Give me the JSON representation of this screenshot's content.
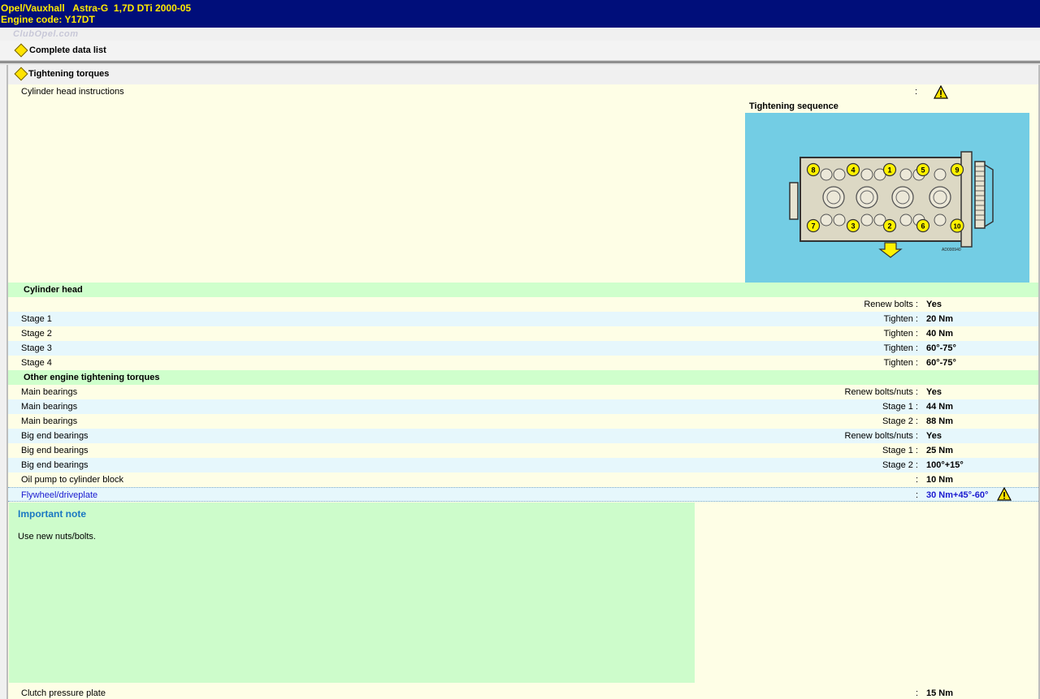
{
  "header": {
    "line1": "Opel/Vauxhall   Astra-G  1,7D DTi 2000-05",
    "line2": "Engine code: Y17DT"
  },
  "watermark": "ClubOpel.com",
  "nav": {
    "complete_data_list": "Complete data list",
    "tightening_torques": "Tightening torques"
  },
  "cylinder_head_instructions": {
    "label": "Cylinder head instructions",
    "colon": ":",
    "icon": "warning-icon"
  },
  "diagram": {
    "title": "Tightening sequence",
    "top_row_bolts": [
      "8",
      "4",
      "1",
      "5",
      "9"
    ],
    "bottom_row_bolts": [
      "7",
      "3",
      "2",
      "6",
      "10"
    ],
    "code": "AD000940"
  },
  "sections": {
    "cylinder_head": "Cylinder head",
    "other": "Other engine tightening torques"
  },
  "cylinder_head_rows": [
    {
      "label": "",
      "key": "Renew bolts :",
      "value": "Yes"
    },
    {
      "label": "Stage 1",
      "key": "Tighten :",
      "value": "20 Nm"
    },
    {
      "label": "Stage 2",
      "key": "Tighten :",
      "value": "40 Nm"
    },
    {
      "label": "Stage 3",
      "key": "Tighten :",
      "value": "60°-75°"
    },
    {
      "label": "Stage 4",
      "key": "Tighten :",
      "value": "60°-75°"
    }
  ],
  "other_rows": [
    {
      "label": "Main bearings",
      "key": "Renew bolts/nuts :",
      "value": "Yes"
    },
    {
      "label": "Main bearings",
      "key": "Stage 1 :",
      "value": "44 Nm"
    },
    {
      "label": "Main bearings",
      "key": "Stage 2 :",
      "value": "88 Nm"
    },
    {
      "label": "Big end bearings",
      "key": "Renew bolts/nuts :",
      "value": "Yes"
    },
    {
      "label": "Big end bearings",
      "key": "Stage 1 :",
      "value": "25 Nm"
    },
    {
      "label": "Big end bearings",
      "key": "Stage 2 :",
      "value": "100°+15°"
    },
    {
      "label": "Oil pump to cylinder block",
      "key": ":",
      "value": "10 Nm"
    },
    {
      "label": "Flywheel/driveplate",
      "key": ":",
      "value": "30 Nm+45°-60°"
    }
  ],
  "important_note": {
    "title": "Important note",
    "text": "Use new nuts/bolts."
  },
  "clutch_row": {
    "label": "Clutch pressure plate",
    "key": ":",
    "value": "15 Nm"
  },
  "colors": {
    "header_bg": "#000e7a",
    "header_text": "#ffe900",
    "content_bg": "#fefee6",
    "row_blue": "#e6f7fc",
    "row_green": "#cfffcc",
    "diagram_bg": "#73cde4",
    "link": "#1a1ad0"
  }
}
